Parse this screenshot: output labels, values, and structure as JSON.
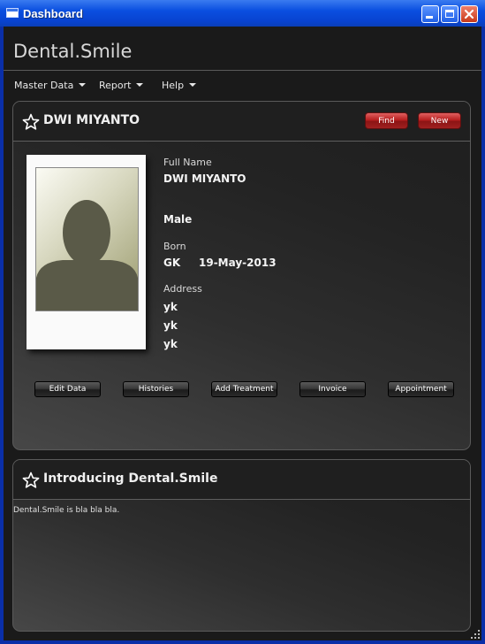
{
  "window": {
    "title": "Dashboard"
  },
  "app": {
    "title": "Dental.Smile"
  },
  "menu": {
    "items": [
      {
        "label": "Master Data"
      },
      {
        "label": "Report"
      },
      {
        "label": "Help"
      }
    ]
  },
  "patient_panel": {
    "title": "DWI MIYANTO",
    "find_label": "Find",
    "new_label": "New",
    "full_name_label": "Full Name",
    "full_name": "DWI MIYANTO",
    "gender": "Male",
    "born_label": "Born",
    "born_place": "GK",
    "born_date": "19-May-2013",
    "address_label": "Address",
    "address_lines": [
      "yk",
      "yk",
      "yk"
    ],
    "actions": [
      {
        "label": "Edit Data"
      },
      {
        "label": "Histories"
      },
      {
        "label": "Add Treatment"
      },
      {
        "label": "Invoice"
      },
      {
        "label": "Appointment"
      }
    ]
  },
  "intro_panel": {
    "title": "Introducing Dental.Smile",
    "text": "Dental.Smile is bla bla bla."
  }
}
